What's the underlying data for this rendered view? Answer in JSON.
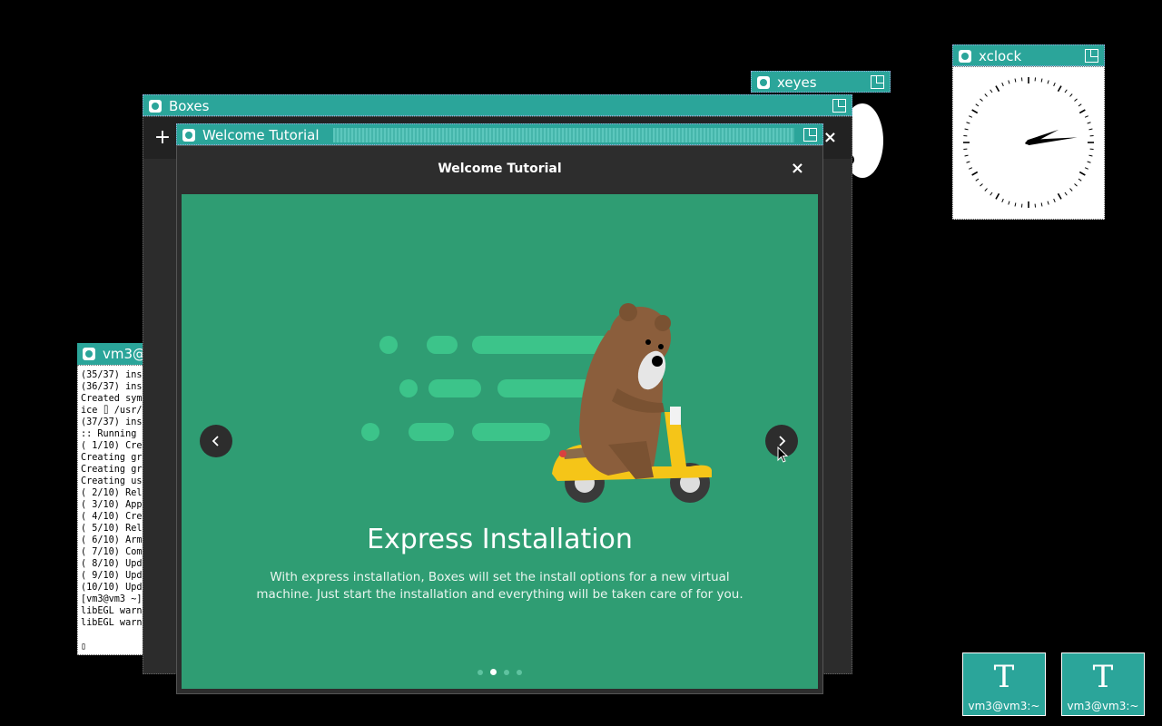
{
  "windows": {
    "boxes": {
      "title": "Boxes",
      "add_label": "+",
      "close_label": "×"
    },
    "tutorial_frame": {
      "title": "Welcome Tutorial"
    },
    "tutorial": {
      "header_title": "Welcome Tutorial",
      "close_label": "×",
      "slide_title": "Express Installation",
      "slide_text_line1": "With express installation, Boxes will set the install options for a new virtual",
      "slide_text_line2": "machine. Just start the installation and everything will be taken care of for you.",
      "current_page": 2,
      "total_pages": 4,
      "accent_color": "#2f9d73"
    },
    "xeyes": {
      "title": "xeyes"
    },
    "xclock": {
      "title": "xclock",
      "time_hint": "2:14"
    },
    "xterm": {
      "title": "vm3@",
      "lines": [
        "(35/37) ins",
        "(36/37) ins",
        "Created sym",
        "ice ⌷ /usr/",
        "(37/37) ins",
        ":: Running ",
        "( 1/10) Cre",
        "Creating gr",
        "Creating gr",
        "Creating us",
        "( 2/10) Rel",
        "( 3/10) App",
        "( 4/10) Cre",
        "( 5/10) Rel",
        "( 6/10) Arm",
        "( 7/10) Com",
        "( 8/10) Upd",
        "( 9/10) Upd",
        "(10/10) Upd",
        "[vm3@vm3 ~]",
        "libEGL warn",
        "libEGL warn",
        "",
        "▯"
      ]
    }
  },
  "icon_manager": [
    {
      "glyph": "T",
      "label": "vm3@vm3:~"
    },
    {
      "glyph": "T",
      "label": "vm3@vm3:~"
    }
  ]
}
